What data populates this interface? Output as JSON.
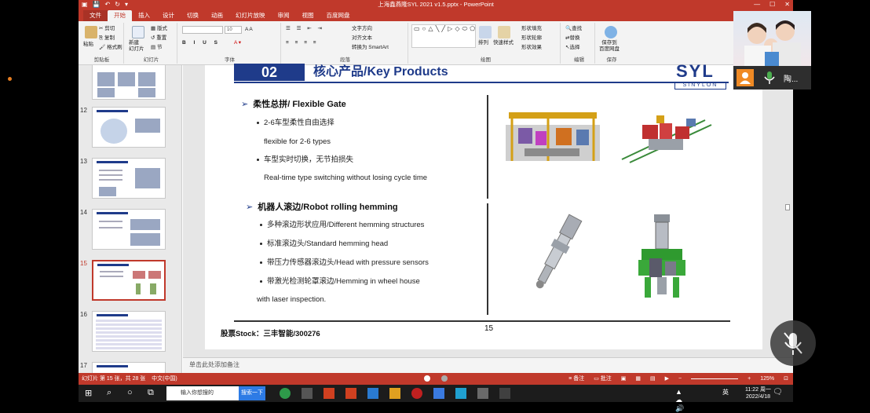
{
  "window": {
    "title": "上海鑫燕隆SYL 2021 v1.5.pptx - PowerPoint",
    "controls": [
      "—",
      "☐",
      "✕"
    ]
  },
  "ribbon": {
    "tabs": [
      "文件",
      "开始",
      "插入",
      "设计",
      "切换",
      "动画",
      "幻灯片放映",
      "审阅",
      "视图",
      "百度网盘"
    ],
    "active_tab": "开始",
    "clipboard": {
      "paste": "粘贴",
      "cut": "剪切",
      "copy": "复制",
      "format_painter": "格式刷",
      "label": "剪贴板"
    },
    "slides": {
      "new_slide": "新建\n幻灯片",
      "layout": "版式",
      "reset": "重置",
      "section": "节",
      "label": "幻灯片"
    },
    "font": {
      "size": "10",
      "label": "字体"
    },
    "paragraph": {
      "text_direction": "文字方向",
      "align_text": "对齐文本",
      "smartart": "转换为 SmartArt",
      "label": "段落"
    },
    "drawing": {
      "arrange": "排列",
      "quick_styles": "快速样式",
      "shape_fill": "形状填充",
      "shape_outline": "形状轮廓",
      "shape_effects": "形状效果",
      "label": "绘图"
    },
    "editing": {
      "find": "查找",
      "replace": "替换",
      "select": "选择",
      "label": "编辑"
    },
    "save": {
      "button": "保存到\n百度网盘",
      "label": "保存"
    }
  },
  "thumbnails": [
    {
      "num": ""
    },
    {
      "num": "12"
    },
    {
      "num": "13"
    },
    {
      "num": "14"
    },
    {
      "num": "15"
    },
    {
      "num": "16"
    },
    {
      "num": "17"
    }
  ],
  "slide": {
    "section_num": "02",
    "title": "核心产品/Key Products",
    "logo": "SYL",
    "logo_sub": "SINYLON",
    "section1": {
      "heading": "柔性总拼/ Flexible Gate",
      "bullets": [
        "2-6车型柔性自由选择",
        "flexible for 2-6 types",
        "车型实时切换，无节拍损失",
        "Real-time type switching without losing cycle time"
      ]
    },
    "section2": {
      "heading": "机器人滚边/Robot rolling hemming",
      "bullets": [
        "多种滚边形状应用/Different hemming structures",
        "标准滚边头/Standard hemming head",
        "带压力传感器滚边头/Head with pressure sensors",
        "带激光检测轮罩滚边/Hemming in wheel house",
        "with laser inspection."
      ]
    },
    "stock": "股票Stock：三丰智能/300276",
    "page_number": "15"
  },
  "notes_placeholder": "单击此处添加备注",
  "statusbar": {
    "slide_info": "幻灯片 第 15 张，共 28 张",
    "language": "中文(中国)",
    "notes": "备注",
    "comments": "批注",
    "zoom": "125%"
  },
  "taskbar": {
    "search_placeholder": "输入你想搜的",
    "search_button": "搜索一下",
    "time": "11:22 周一",
    "date": "2022/4/18",
    "ime": "英"
  },
  "video_call": {
    "participant": "陶..."
  },
  "colors": {
    "accent": "#c0392b",
    "slide_blue": "#1f3b8a"
  }
}
